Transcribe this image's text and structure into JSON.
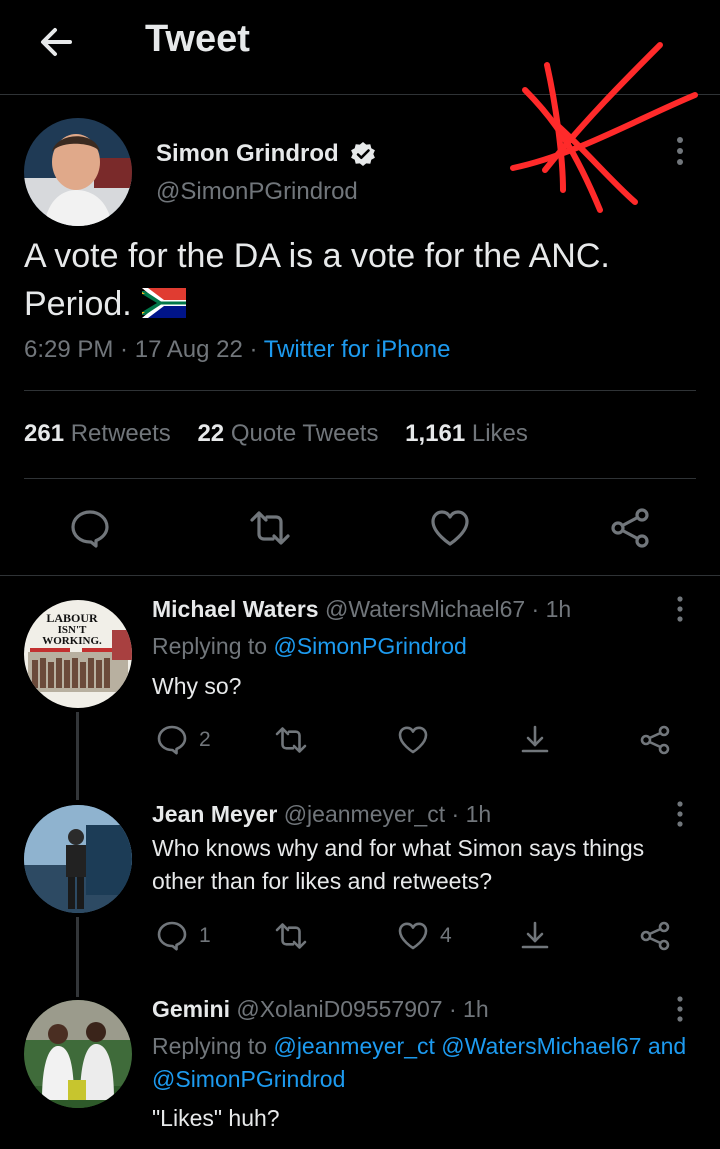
{
  "header": {
    "title": "Tweet"
  },
  "tweet": {
    "author_name": "Simon Grindrod",
    "author_handle": "@SimonPGrindrod",
    "text": "A vote for the DA is a vote for the ANC. Period.",
    "time": "6:29 PM",
    "date": "17 Aug 22",
    "source": "Twitter for iPhone",
    "retweets_count": "261",
    "retweets_label": "Retweets",
    "quotes_count": "22",
    "quotes_label": "Quote Tweets",
    "likes_count": "1,161",
    "likes_label": "Likes"
  },
  "replies": [
    {
      "name": "Michael Waters",
      "handle": "@WatersMichael67",
      "time": "1h",
      "replying_prefix": "Replying to",
      "replying_to": "@SimonPGrindrod",
      "text": "Why so?",
      "reply_count": "2",
      "like_count": "",
      "avatar_text": [
        "LABOUR",
        "ISN'T",
        "WORKING."
      ]
    },
    {
      "name": "Jean Meyer",
      "handle": "@jeanmeyer_ct",
      "time": "1h",
      "text": "Who knows why and for what Simon says things other than for likes and retweets?",
      "reply_count": "1",
      "like_count": "4"
    },
    {
      "name": "Gemini",
      "handle": "@XolaniD09557907",
      "time": "1h",
      "replying_prefix": "Replying to",
      "replying_to_1": "@jeanmeyer_ct",
      "replying_to_2": "@WatersMichael67",
      "replying_and": "and",
      "replying_to_3": "@SimonPGrindrod",
      "text": "\"Likes\" huh?"
    }
  ],
  "colors": {
    "background": "#000000",
    "text": "#e7e9ea",
    "muted": "#71767b",
    "link": "#1d9bf0",
    "divider": "#2f3336",
    "scribble": "#ff2a2a"
  }
}
